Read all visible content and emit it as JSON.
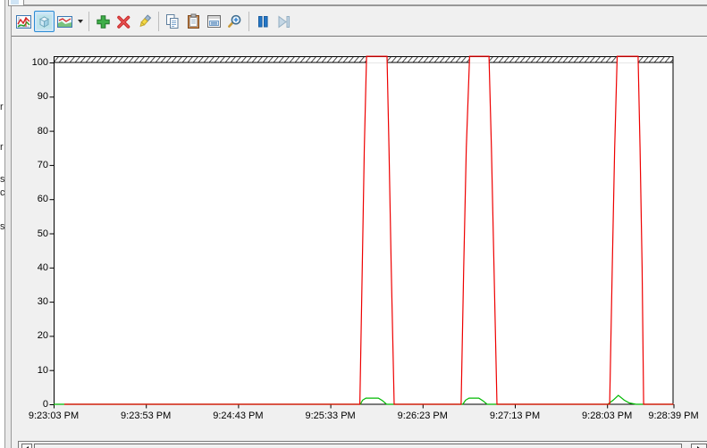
{
  "sidebar": {
    "partial_letters": [
      {
        "char": "r",
        "y": 114
      },
      {
        "char": "r",
        "y": 159
      },
      {
        "char": "s",
        "y": 195
      },
      {
        "char": "c",
        "y": 210
      },
      {
        "char": "s",
        "y": 248
      }
    ]
  },
  "toolbar": {
    "buttons": [
      {
        "name": "view-current-activity",
        "icon": "chart-line-icon",
        "selected": false
      },
      {
        "name": "view-log-data",
        "icon": "cube-icon",
        "selected": true
      },
      {
        "name": "change-graph-type",
        "icon": "graph-image-icon",
        "selected": false,
        "dropdown": true
      },
      {
        "sep": true
      },
      {
        "name": "add-counter",
        "icon": "plus-icon",
        "selected": false
      },
      {
        "name": "delete-counter",
        "icon": "red-x-icon",
        "selected": false
      },
      {
        "name": "highlight",
        "icon": "highlighter-icon",
        "selected": false
      },
      {
        "sep": true
      },
      {
        "name": "copy-properties",
        "icon": "copy-icon",
        "selected": false
      },
      {
        "name": "paste-counter-list",
        "icon": "clipboard-icon",
        "selected": false
      },
      {
        "name": "properties",
        "icon": "properties-icon",
        "selected": false
      },
      {
        "name": "zoom",
        "icon": "magnifier-icon",
        "selected": false
      },
      {
        "sep": true
      },
      {
        "name": "freeze-display",
        "icon": "pause-icon",
        "selected": false
      },
      {
        "name": "update-data",
        "icon": "step-forward-icon",
        "selected": false
      }
    ]
  },
  "chart_data": {
    "type": "line",
    "title": "",
    "xlabel": "",
    "ylabel": "",
    "grid": "none",
    "top_band": "hatched-ceiling",
    "hatch_color": "#444444",
    "x_axis": {
      "span_seconds": 336,
      "ticks": [
        {
          "label": "9:23:03 PM",
          "s": 0
        },
        {
          "label": "9:23:53 PM",
          "s": 50
        },
        {
          "label": "9:24:43 PM",
          "s": 100
        },
        {
          "label": "9:25:33 PM",
          "s": 150
        },
        {
          "label": "9:26:23 PM",
          "s": 200
        },
        {
          "label": "9:27:13 PM",
          "s": 250
        },
        {
          "label": "9:28:03 PM",
          "s": 300
        },
        {
          "label": "9:28:39 PM",
          "s": 336
        }
      ]
    },
    "y_axis": {
      "min": 0,
      "max": 100,
      "tick_step": 10,
      "ticks": [
        100,
        90,
        80,
        70,
        60,
        50,
        40,
        30,
        20,
        10,
        0
      ]
    },
    "overshoot_max": 101.8,
    "series": [
      {
        "name": "red-counter",
        "color": "#ee0000",
        "points": [
          [
            5.8,
            0
          ],
          [
            166,
            0
          ],
          [
            167.3,
            40
          ],
          [
            168.4,
            75
          ],
          [
            169.6,
            101.8
          ],
          [
            180.7,
            101.8
          ],
          [
            181.8,
            75
          ],
          [
            183,
            40
          ],
          [
            184.6,
            0
          ],
          [
            220.9,
            0
          ],
          [
            222.3,
            40
          ],
          [
            223.7,
            75
          ],
          [
            225.5,
            101.8
          ],
          [
            236,
            101.8
          ],
          [
            237.3,
            75
          ],
          [
            238.7,
            40
          ],
          [
            240.3,
            0
          ],
          [
            301.4,
            0
          ],
          [
            302.8,
            40
          ],
          [
            304.1,
            75
          ],
          [
            305.5,
            101.8
          ],
          [
            316.8,
            101.8
          ],
          [
            317.9,
            75
          ],
          [
            319,
            40
          ],
          [
            319.8,
            0
          ],
          [
            336,
            0
          ]
        ]
      },
      {
        "name": "green-counter",
        "color": "#00b800",
        "points": [
          [
            0,
            0
          ],
          [
            166.3,
            0
          ],
          [
            167.5,
            1.2
          ],
          [
            169.3,
            1.8
          ],
          [
            176,
            1.8
          ],
          [
            178.2,
            1.1
          ],
          [
            180.5,
            0
          ],
          [
            221.8,
            0
          ],
          [
            223.3,
            1.2
          ],
          [
            225.2,
            1.8
          ],
          [
            230.5,
            1.8
          ],
          [
            232.8,
            1.0
          ],
          [
            235,
            0
          ],
          [
            300.4,
            0
          ],
          [
            303.3,
            1.2
          ],
          [
            306.1,
            2.6
          ],
          [
            309.3,
            1.2
          ],
          [
            312,
            0.4
          ],
          [
            315.7,
            0
          ],
          [
            336,
            0
          ]
        ]
      }
    ]
  },
  "scrollbar": {
    "orientation": "horizontal"
  }
}
